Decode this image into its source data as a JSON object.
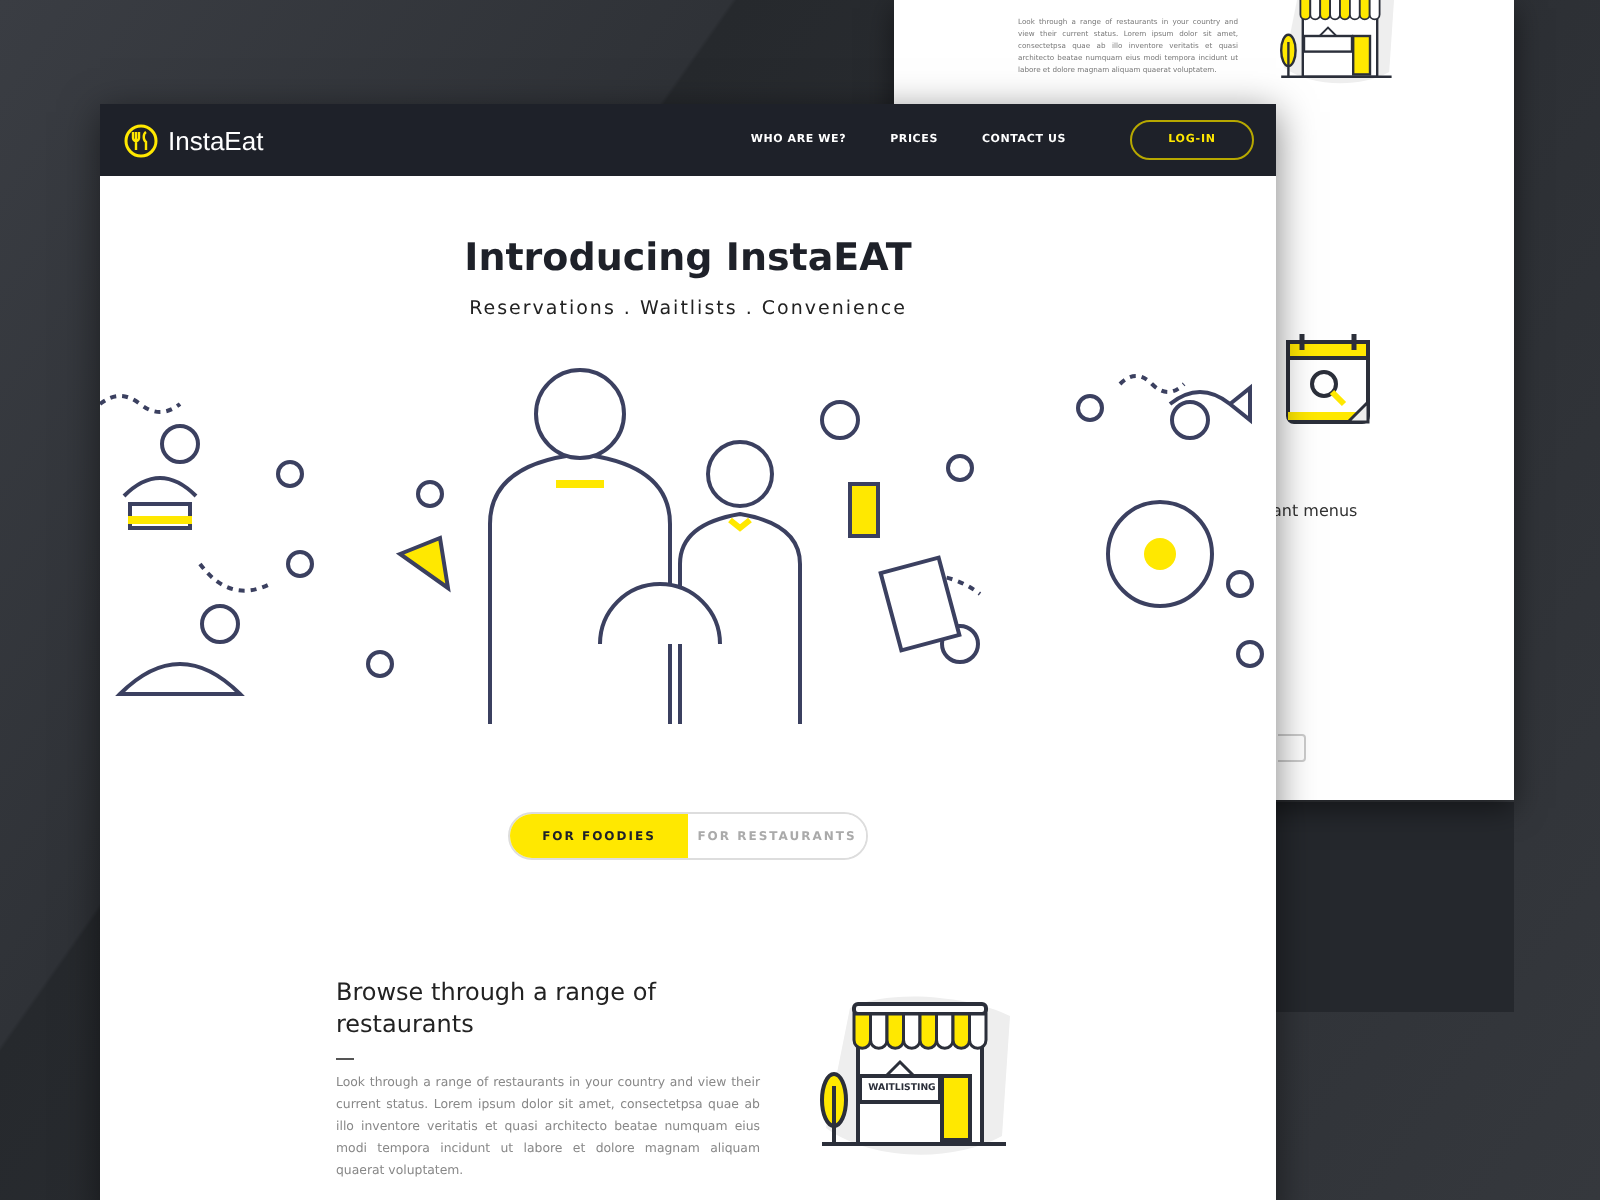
{
  "back_page": {
    "feature_body": "Look through a range of restaurants in your country and view their current status. Lorem ipsum dolor sit amet, consectetpsa quae ab illo inventore veritatis et quasi architecto beatae  numquam eius modi tempora incidunt ut labore et dolore magnam aliquam quaerat voluptatem.",
    "heading_fragment": "ant menus"
  },
  "brand": {
    "name": "InstaEat"
  },
  "nav": {
    "links": [
      "WHO ARE WE?",
      "PRICES",
      "CONTACT US"
    ],
    "login": "LOG-IN"
  },
  "hero": {
    "title": "Introducing InstaEAT",
    "subtitle": "Reservations . Waitlists . Convenience"
  },
  "audience_tabs": [
    {
      "label": "FOR FOODIES",
      "selected": true
    },
    {
      "label": "FOR RESTAURANTS",
      "selected": false
    }
  ],
  "feature": {
    "heading": "Browse through a range of restaurants",
    "body": "Look through a range of restaurants in your country and view their current status. Lorem ipsum dolor sit amet, consectetpsa quae ab illo inventore veritatis et quasi architecto beatae  numquam eius modi tempora incidunt ut labore et dolore magnam aliquam quaerat voluptatem.",
    "store_sign": "WAITLISTING"
  }
}
